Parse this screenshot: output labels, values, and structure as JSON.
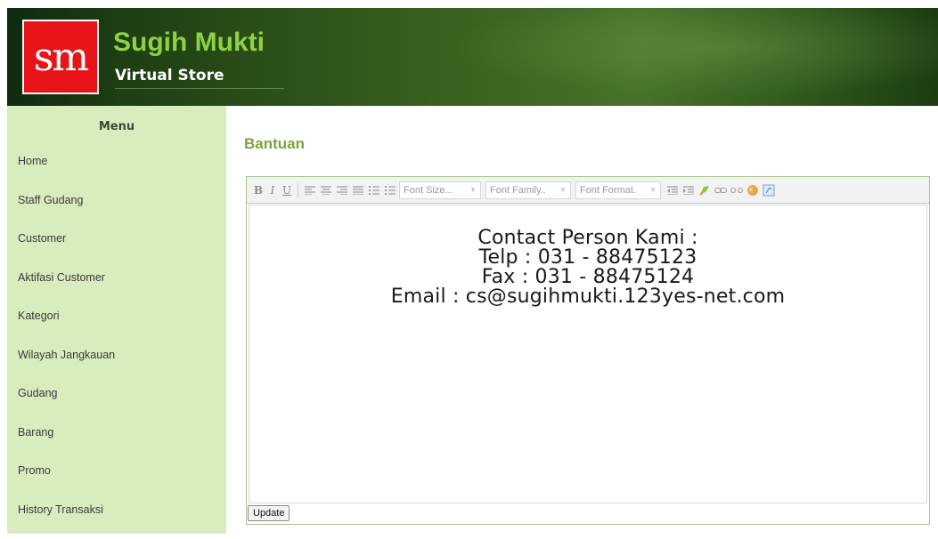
{
  "header": {
    "logo_text": "sm",
    "title": "Sugih Mukti",
    "subtitle": "Virtual Store"
  },
  "sidebar": {
    "title": "Menu",
    "items": [
      {
        "label": "Home"
      },
      {
        "label": "Staff Gudang"
      },
      {
        "label": "Customer"
      },
      {
        "label": "Aktifasi Customer"
      },
      {
        "label": "Kategori"
      },
      {
        "label": "Wilayah Jangkauan"
      },
      {
        "label": "Gudang"
      },
      {
        "label": "Barang"
      },
      {
        "label": "Promo"
      },
      {
        "label": "History Transaksi"
      }
    ]
  },
  "main": {
    "heading": "Bantuan",
    "toolbar": {
      "bold": "B",
      "italic": "I",
      "underline": "U",
      "font_size": "Font Size...",
      "font_family": "Font Family..",
      "font_format": "Font Format."
    },
    "editor_lines": [
      "Contact Person Kami :",
      "Telp : 031 - 88475123",
      "Fax : 031 - 88475124",
      "Email : cs@sugihmukti.123yes-net.com"
    ],
    "update_label": "Update"
  },
  "colors": {
    "brand_green": "#8fd140",
    "sidebar_bg": "#d8edbd",
    "heading_green": "#7aa63a",
    "logo_red": "#e8141a"
  }
}
